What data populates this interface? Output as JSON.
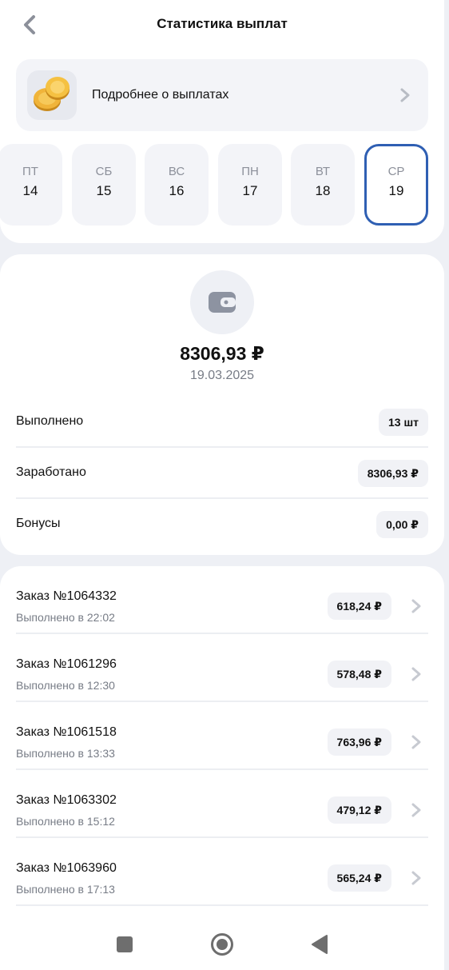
{
  "header": {
    "title": "Статистика выплат",
    "back_icon": "chevron-left-icon"
  },
  "payouts_link": {
    "label": "Подробнее о выплатах",
    "icon": "coins-icon"
  },
  "days": [
    {
      "name": "ПТ",
      "num": "14",
      "selected": false
    },
    {
      "name": "СБ",
      "num": "15",
      "selected": false
    },
    {
      "name": "ВС",
      "num": "16",
      "selected": false
    },
    {
      "name": "ПН",
      "num": "17",
      "selected": false
    },
    {
      "name": "ВТ",
      "num": "18",
      "selected": false
    },
    {
      "name": "СР",
      "num": "19",
      "selected": true
    }
  ],
  "summary": {
    "icon": "wallet-icon",
    "total": "8306,93 ₽",
    "date": "19.03.2025",
    "stats": [
      {
        "label": "Выполнено",
        "value": "13 шт"
      },
      {
        "label": "Заработано",
        "value": "8306,93 ₽"
      },
      {
        "label": "Бонусы",
        "value": "0,00 ₽"
      }
    ]
  },
  "orders": [
    {
      "title": "Заказ №1064332",
      "subtitle": "Выполнено в 22:02",
      "amount": "618,24 ₽"
    },
    {
      "title": "Заказ №1061296",
      "subtitle": "Выполнено в 12:30",
      "amount": "578,48 ₽"
    },
    {
      "title": "Заказ №1061518",
      "subtitle": "Выполнено в 13:33",
      "amount": "763,96 ₽"
    },
    {
      "title": "Заказ №1063302",
      "subtitle": "Выполнено в 15:12",
      "amount": "479,12 ₽"
    },
    {
      "title": "Заказ №1063960",
      "subtitle": "Выполнено в 17:13",
      "amount": "565,24 ₽"
    }
  ],
  "navbar": {
    "icons": [
      "square-recents-icon",
      "circle-home-icon",
      "triangle-back-icon"
    ]
  },
  "colors": {
    "accent": "#2f5fb3",
    "background": "#eef0f5",
    "card": "#ffffff",
    "muted": "#777c86",
    "coin": "#f0b43a"
  }
}
